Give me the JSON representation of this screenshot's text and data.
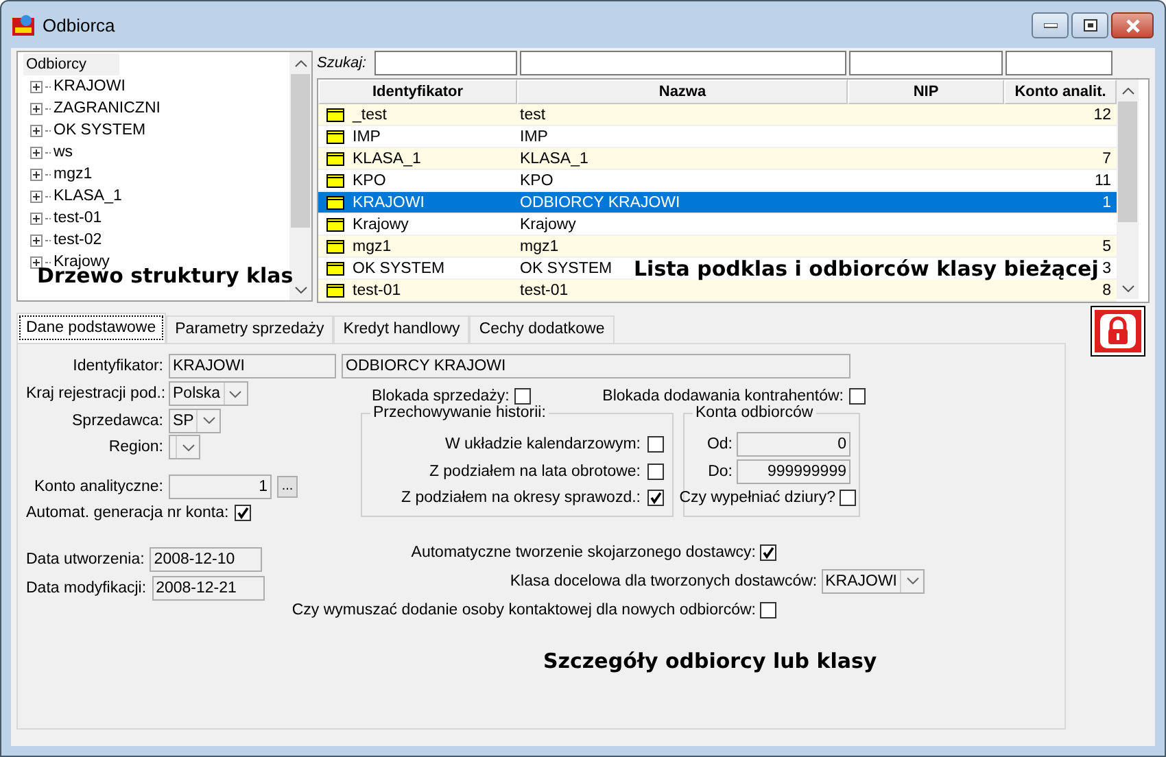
{
  "window": {
    "title": "Odbiorca"
  },
  "tree": {
    "root": "Odbiorcy",
    "items": [
      {
        "label": "KRAJOWI",
        "expanded": false
      },
      {
        "label": "ZAGRANICZNI",
        "expanded": false
      },
      {
        "label": "OK SYSTEM",
        "expanded": false
      },
      {
        "label": "ws",
        "expanded": false
      },
      {
        "label": "mgz1",
        "expanded": false
      },
      {
        "label": "KLASA_1",
        "expanded": false
      },
      {
        "label": "test-01",
        "expanded": false
      },
      {
        "label": "test-02",
        "expanded": false
      },
      {
        "label": "Krajowy",
        "expanded": false
      }
    ]
  },
  "search": {
    "label": "Szukaj:"
  },
  "table": {
    "columns": [
      "Identyfikator",
      "Nazwa",
      "NIP",
      "Konto analit."
    ],
    "rows": [
      {
        "identyfikator": "_test",
        "nazwa": "test",
        "konto": "12",
        "selected": false
      },
      {
        "identyfikator": "IMP",
        "nazwa": "IMP",
        "selected": false
      },
      {
        "identyfikator": "KLASA_1",
        "nazwa": "KLASA_1",
        "konto": "7",
        "selected": false
      },
      {
        "identyfikator": "KPO",
        "nazwa": "KPO",
        "konto": "11",
        "selected": false
      },
      {
        "identyfikator": "KRAJOWI",
        "nazwa": "ODBIORCY KRAJOWI",
        "konto": "1",
        "selected": true
      },
      {
        "identyfikator": "Krajowy",
        "nazwa": "Krajowy",
        "selected": false
      },
      {
        "identyfikator": "mgz1",
        "nazwa": "mgz1",
        "konto": "5",
        "selected": false
      },
      {
        "identyfikator": "OK SYSTEM",
        "nazwa": "OK SYSTEM",
        "konto": "3",
        "selected": false
      },
      {
        "identyfikator": "test-01",
        "nazwa": "test-01",
        "konto": "8",
        "selected": false
      }
    ]
  },
  "tabs": [
    {
      "label": "Dane podstawowe",
      "selected": true
    },
    {
      "label": "Parametry sprzedaży",
      "selected": false
    },
    {
      "label": "Kredyt handlowy",
      "selected": false
    },
    {
      "label": "Cechy dodatkowe",
      "selected": false
    }
  ],
  "form": {
    "identyfikator": {
      "label": "Identyfikator:",
      "value": "KRAJOWI",
      "name_value": "ODBIORCY KRAJOWI"
    },
    "kraj": {
      "label": "Kraj rejestracji pod.:",
      "value": "Polska"
    },
    "sprzedawca": {
      "label": "Sprzedawca:",
      "value": "SP"
    },
    "region": {
      "label": "Region:"
    },
    "konto": {
      "label": "Konto analityczne:",
      "value": "1",
      "button": "..."
    },
    "automat": {
      "label": "Automat. generacja nr konta:",
      "checked": true
    },
    "blokada_sprzedazy": {
      "label": "Blokada sprzedaży:",
      "checked": false
    },
    "blokada_dodawania": {
      "label": "Blokada dodawania kontrahentów:",
      "checked": false
    },
    "historia": {
      "title": "Przechowywanie historii:",
      "options": [
        {
          "label": "W układzie kalendarzowym:",
          "checked": false
        },
        {
          "label": "Z podziałem na lata obrotowe:",
          "checked": false
        },
        {
          "label": "Z podziałem na okresy sprawozd.:",
          "checked": true
        }
      ]
    },
    "konta": {
      "title": "Konta odbiorców",
      "od": {
        "label": "Od:",
        "value": "0"
      },
      "do": {
        "label": "Do:",
        "value": "999999999"
      },
      "dziury": {
        "label": "Czy wypełniać dziury?",
        "checked": false
      }
    },
    "data_utworzenia": {
      "label": "Data utworzenia:",
      "value": "2008-12-10"
    },
    "data_modyfikacji": {
      "label": "Data modyfikacji:",
      "value": "2008-12-21"
    },
    "auto_dostawca": {
      "label": "Automatyczne tworzenie skojarzonego dostawcy:",
      "checked": true
    },
    "klasa_docelowa": {
      "label": "Klasa docelowa dla tworzonych dostawców:",
      "value": "KRAJOWI"
    },
    "wymuszac": {
      "label": "Czy wymuszać dodanie osoby kontaktowej dla nowych odbiorców:",
      "checked": false
    }
  },
  "annotations": [
    "Drzewo struktury klas",
    "Lista podklas i odbiorców klasy bieżącej",
    "Szczegóły odbiorcy lub klasy"
  ]
}
